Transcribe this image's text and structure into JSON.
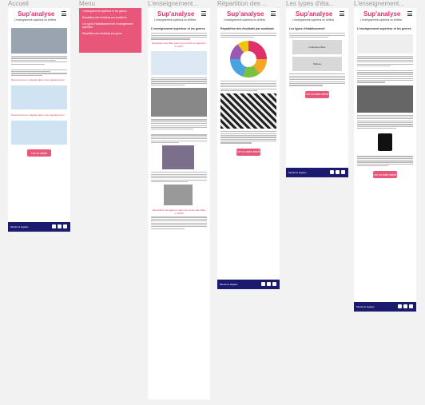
{
  "frames": {
    "accueil": "Accueil",
    "menu": "Menu",
    "enseignement": "L'enseignement...",
    "repartition": "Répartition des ...",
    "types": "Les types d'éta...",
    "enseignement2": "L'enseignement..."
  },
  "brand": "Sup'analyse",
  "tagline": "L'enseignement supérieur en chiffres",
  "menu_items": [
    "L'enseignement supérieur et les genres",
    "Répartition des étudiants par académie",
    "Les types d'établissement de l'enseignement supérieur",
    "Répartition des étudiants par genre"
  ],
  "accueil": {
    "links": [
      "Découvrez-le en cliquant dans votre département !",
      "Découvrez-le en cliquant dans votre département !"
    ],
    "button": "Lire un article",
    "footer": "Mentions légales"
  },
  "article1": {
    "title": "L'enseignement supérieur et les genres",
    "chart_caption": "Répartition des filles parmi les inscrits du supérieur en 2017",
    "caption2": "Répartition des garçons selon les zones des villes en 2016",
    "footer": "Mentions légales"
  },
  "article2": {
    "title": "Répartition des étudiants par académie",
    "button": "Lire un autre article",
    "footer": "Mentions légales"
  },
  "article3": {
    "title": "Les types d'établissement",
    "block1": "Graphique Bars",
    "block2": "Tableau",
    "button": "Lire un autre article",
    "footer": "Mentions légales"
  },
  "article4": {
    "title": "L'enseignement supérieur et les genres",
    "button": "Lire un autre article",
    "footer": "Mentions légales"
  },
  "colors": {
    "accent": "#e0306a",
    "button": "#e8567a",
    "footer": "#1b1a6e"
  }
}
